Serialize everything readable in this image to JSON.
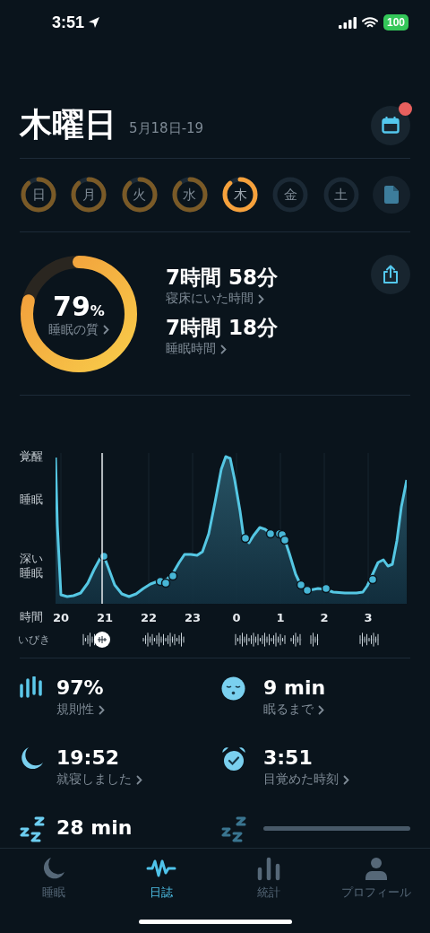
{
  "status_bar": {
    "time": "3:51",
    "battery": "100"
  },
  "header": {
    "title": "木曜日",
    "date_range": "5月18日-19",
    "calendar_badge": true
  },
  "days": [
    {
      "label": "日",
      "recorded": true,
      "selected": false
    },
    {
      "label": "月",
      "recorded": true,
      "selected": false
    },
    {
      "label": "火",
      "recorded": true,
      "selected": false
    },
    {
      "label": "水",
      "recorded": true,
      "selected": false
    },
    {
      "label": "木",
      "recorded": true,
      "selected": true
    },
    {
      "label": "金",
      "recorded": false,
      "selected": false
    },
    {
      "label": "土",
      "recorded": false,
      "selected": false
    }
  ],
  "summary": {
    "quality": "79",
    "quality_unit": "%",
    "quality_label": "睡眠の質",
    "stats": [
      {
        "value": "7時間 58分",
        "label": "寝床にいた時間"
      },
      {
        "value": "7時間 18分",
        "label": "睡眠時間"
      }
    ]
  },
  "chart": {
    "y_labels": [
      "覚醒",
      "睡眠",
      "深い睡眠"
    ],
    "x_title": "時間",
    "x_labels": [
      "20",
      "21",
      "22",
      "23",
      "0",
      "1",
      "2",
      "3"
    ],
    "snore_label": "いびき"
  },
  "metrics": [
    {
      "kind": "regularity",
      "value": "97%",
      "label": "規則性"
    },
    {
      "kind": "fall_asleep",
      "value": "9 min",
      "label": "眠るまで"
    },
    {
      "kind": "bedtime",
      "value": "19:52",
      "label": "就寝しました"
    },
    {
      "kind": "wake",
      "value": "3:51",
      "label": "目覚めた時刻"
    },
    {
      "kind": "snore",
      "value": "28 min"
    },
    {
      "kind": "loading"
    }
  ],
  "tabs": [
    {
      "label": "睡眠",
      "selected": false
    },
    {
      "label": "日誌",
      "selected": true
    },
    {
      "label": "統計",
      "selected": false
    },
    {
      "label": "プロフィール",
      "selected": false
    }
  ]
}
